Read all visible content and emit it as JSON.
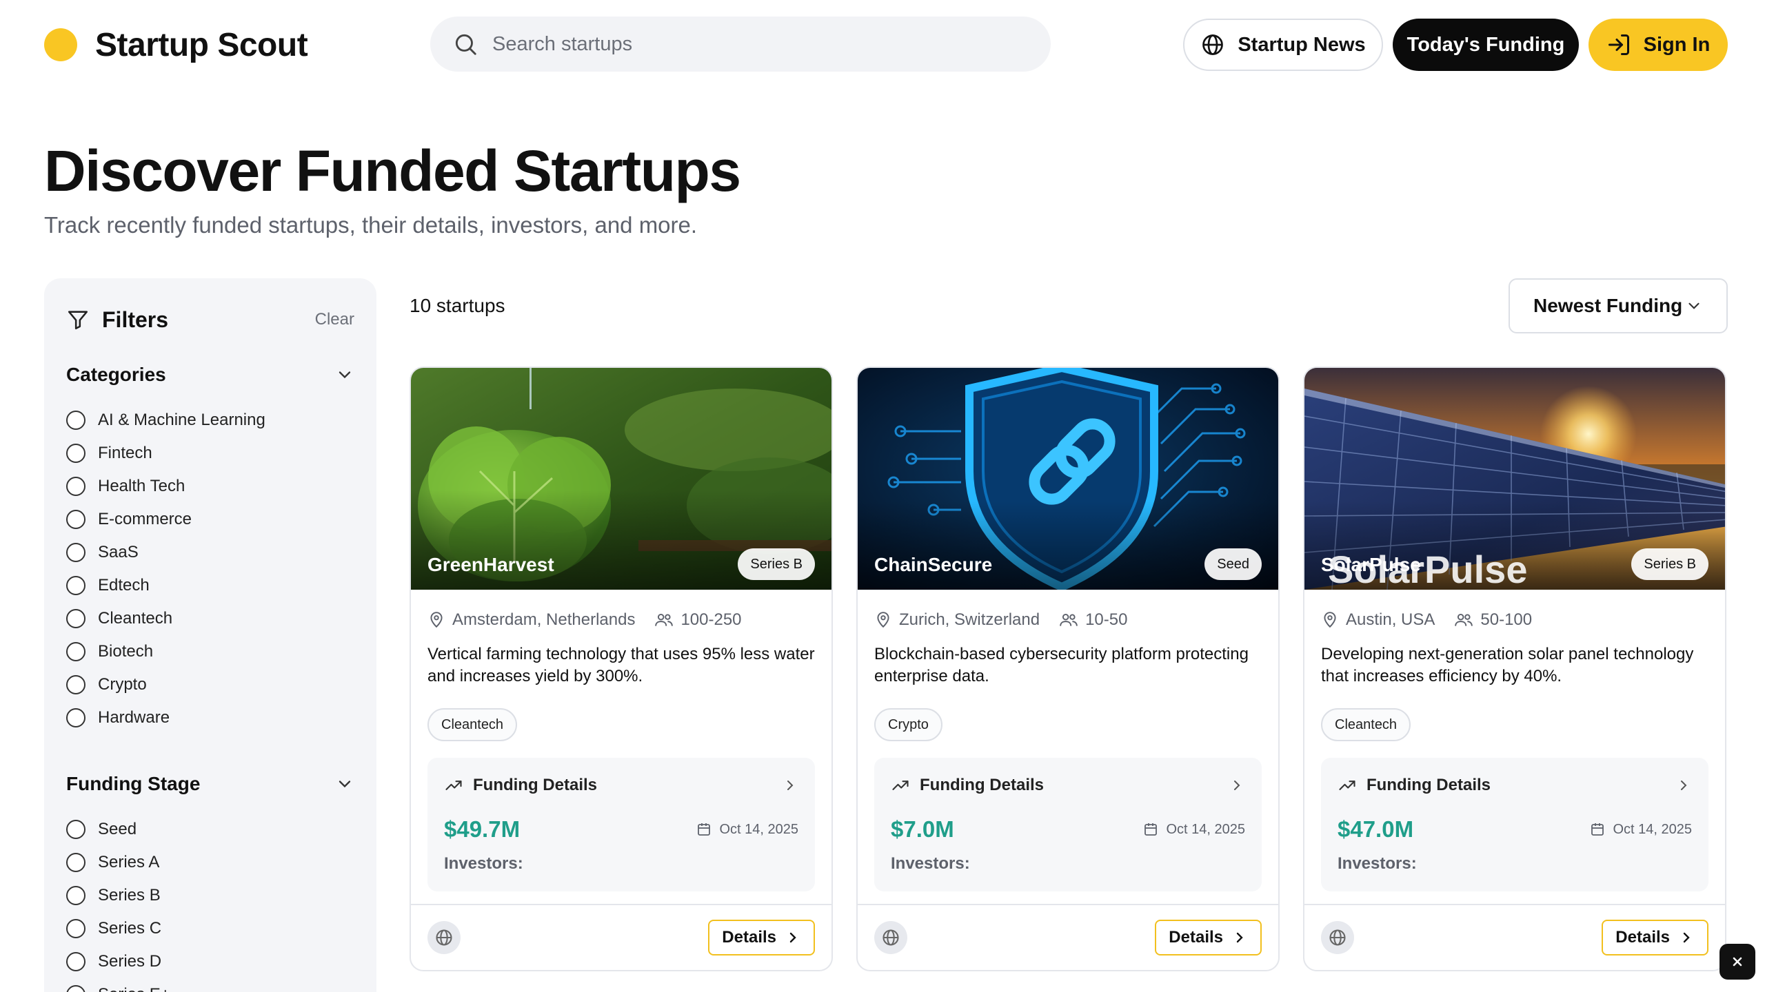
{
  "header": {
    "brand": "Startup Scout",
    "search_placeholder": "Search startups",
    "news_label": "Startup News",
    "funding_label": "Today's Funding",
    "signin_label": "Sign In",
    "accent_color": "#F9C623"
  },
  "hero": {
    "title": "Discover Funded Startups",
    "subtitle": "Track recently funded startups, their details, investors, and more."
  },
  "filters": {
    "title": "Filters",
    "clear_label": "Clear",
    "categories_title": "Categories",
    "categories": [
      "AI & Machine Learning",
      "Fintech",
      "Health Tech",
      "E-commerce",
      "SaaS",
      "Edtech",
      "Cleantech",
      "Biotech",
      "Crypto",
      "Hardware"
    ],
    "stage_title": "Funding Stage",
    "stages": [
      "Seed",
      "Series A",
      "Series B",
      "Series C",
      "Series D",
      "Series E+"
    ]
  },
  "results": {
    "count_label": "10 startups",
    "sort_label": "Newest Funding"
  },
  "cards": [
    {
      "name": "GreenHarvest",
      "stage": "Series B",
      "location": "Amsterdam, Netherlands",
      "team_size": "100-250",
      "description": "Vertical farming technology that uses 95% less water and increases yield by 300%.",
      "tag": "Cleantech",
      "funding_title": "Funding Details",
      "amount": "$49.7M",
      "date": "Oct 14, 2025",
      "investors_label": "Investors:",
      "details_label": "Details"
    },
    {
      "name": "ChainSecure",
      "stage": "Seed",
      "location": "Zurich, Switzerland",
      "team_size": "10-50",
      "description": "Blockchain-based cybersecurity platform protecting enterprise data.",
      "tag": "Crypto",
      "funding_title": "Funding Details",
      "amount": "$7.0M",
      "date": "Oct 14, 2025",
      "investors_label": "Investors:",
      "details_label": "Details"
    },
    {
      "name": "SolarPulse",
      "stage": "Series B",
      "location": "Austin, USA",
      "team_size": "50-100",
      "description": "Developing next-generation solar panel technology that increases efficiency by 40%.",
      "tag": "Cleantech",
      "funding_title": "Funding Details",
      "amount": "$47.0M",
      "date": "Oct 14, 2025",
      "investors_label": "Investors:",
      "details_label": "Details",
      "image_text": "SolarPulse"
    }
  ]
}
